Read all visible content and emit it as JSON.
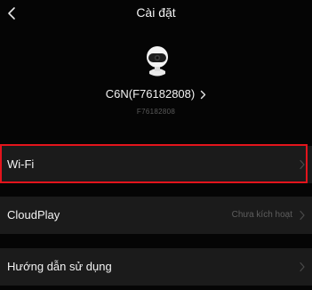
{
  "nav": {
    "title": "Cài đặt",
    "back_icon": "chevron-left-icon"
  },
  "device": {
    "icon": "camera-icon",
    "name": "C6N(F76182808)",
    "name_chevron": "chevron-right-icon",
    "serial": "F76182808"
  },
  "rows": [
    {
      "label": "Wi-Fi",
      "value": "",
      "highlighted": true,
      "arrow": "chevron-right-icon"
    },
    {
      "label": "CloudPlay",
      "value": "Chưa kích hoạt",
      "highlighted": false,
      "arrow": "chevron-right-icon"
    },
    {
      "label": "Hướng dẫn sử dụng",
      "value": "",
      "highlighted": false,
      "arrow": "chevron-right-icon"
    }
  ],
  "colors": {
    "background": "#050505",
    "row_background": "#1b1b1b",
    "highlight_border": "#e3141c",
    "secondary_text": "#5e5e5e"
  }
}
